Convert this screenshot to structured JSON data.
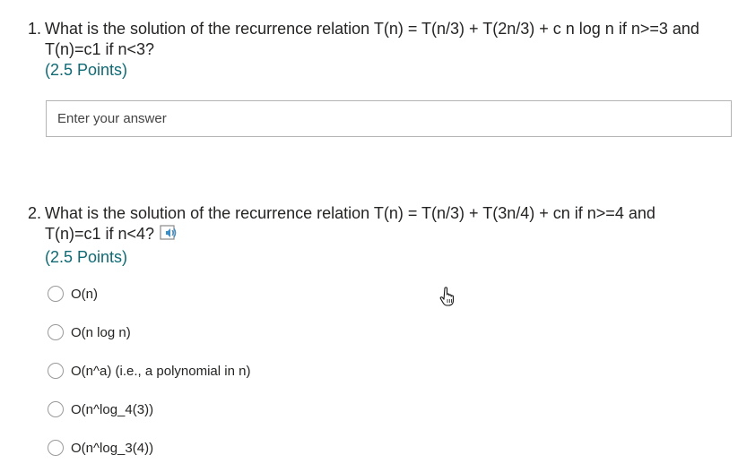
{
  "questions": [
    {
      "number": "1.",
      "text_line1": "What is the solution of the recurrence relation T(n) = T(n/3) + T(2n/3) + c n log n if n>=3 and",
      "text_line2": "T(n)=c1 if n<3?",
      "points": "(2.5 Points)",
      "answer_placeholder": "Enter your answer"
    },
    {
      "number": "2.",
      "text_line1": "What is the solution of the recurrence relation T(n) = T(n/3) + T(3n/4) + cn if n>=4 and",
      "text_line2": "T(n)=c1 if n<4?",
      "points": "(2.5 Points)",
      "tts_icon": "speaker-icon",
      "options": [
        "O(n)",
        "O(n log n)",
        "O(n^a) (i.e., a polynomial in n)",
        "O(n^log_4(3))",
        "O(n^log_3(4))"
      ]
    }
  ],
  "colors": {
    "points": "#0f6a74",
    "text": "#252423",
    "border": "#b4b4b4"
  },
  "cursor_icon": "hand-pointer-icon"
}
